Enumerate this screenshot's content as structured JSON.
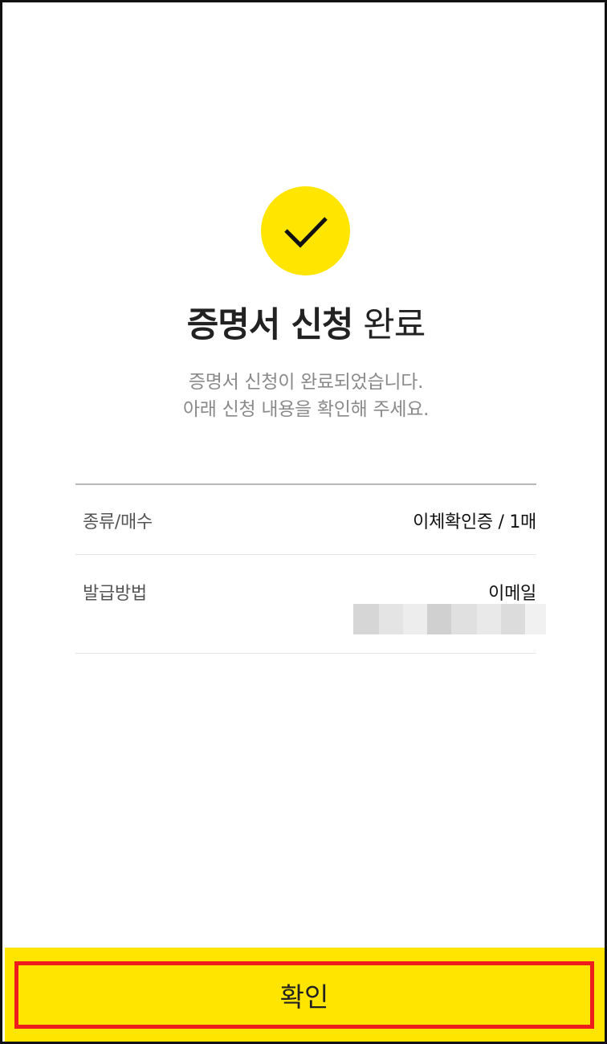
{
  "result": {
    "title_bold": "증명서 신청",
    "title_light": "완료",
    "message_line1": "증명서 신청이 완료되었습니다.",
    "message_line2": "아래 신청 내용을 확인해 주세요."
  },
  "details": {
    "rows": [
      {
        "label": "종류/매수",
        "value": "이체확인증 / 1매"
      },
      {
        "label": "발급방법",
        "value": "이메일"
      }
    ]
  },
  "footer": {
    "confirm_label": "확인"
  },
  "icons": {
    "success": "check-icon"
  },
  "colors": {
    "accent": "#ffe500",
    "highlight_border": "#ee1c1c"
  }
}
